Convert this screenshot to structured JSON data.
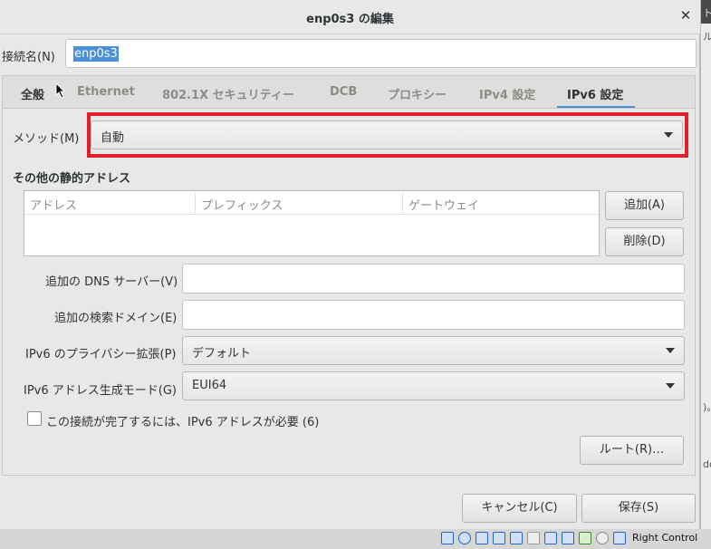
{
  "window": {
    "title": "enp0s3 の編集"
  },
  "connection": {
    "label": "接続名(N)",
    "value": "enp0s3"
  },
  "tabs": [
    {
      "label": "全般"
    },
    {
      "label": "Ethernet"
    },
    {
      "label": "802.1X セキュリティー"
    },
    {
      "label": "DCB"
    },
    {
      "label": "プロキシー"
    },
    {
      "label": "IPv4 設定"
    },
    {
      "label": "IPv6 設定"
    }
  ],
  "active_tab": "IPv6 設定",
  "method": {
    "label": "メソッド(M)",
    "value": "自動"
  },
  "addresses": {
    "title": "その他の静的アドレス",
    "columns": [
      "アドレス",
      "プレフィックス",
      "ゲートウェイ"
    ],
    "add_button": "追加(A)",
    "delete_button": "削除(D)"
  },
  "dns": {
    "label": "追加の DNS サーバー(V)",
    "value": ""
  },
  "search_domains": {
    "label": "追加の検索ドメイン(E)",
    "value": ""
  },
  "privacy": {
    "label": "IPv6 のプライバシー拡張(P)",
    "value": "デフォルト"
  },
  "addr_gen_mode": {
    "label": "IPv6 アドレス生成モード(G)",
    "value": "EUI64"
  },
  "require_ipv6": {
    "label": "この接続が完了するには、IPv6 アドレスが必要 (6)",
    "checked": false
  },
  "routes_button": "ルート(R)…",
  "cancel_button": "キャンセル(C)",
  "save_button": "保存(S)",
  "taskbar": {
    "host_key": "Right Control"
  },
  "background_window": {
    "chips": [
      "ト",
      "ル",
      ")。",
      "do"
    ]
  },
  "colors": {
    "accent": "#4a90d9",
    "highlight_box": "#e0202a"
  }
}
